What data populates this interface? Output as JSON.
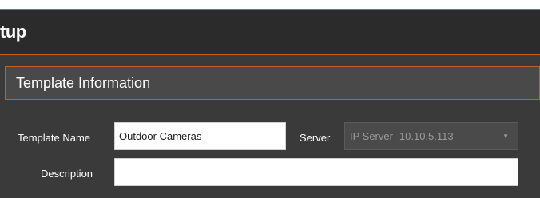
{
  "dialog": {
    "title": "tup"
  },
  "section": {
    "title": "Template Information"
  },
  "form": {
    "template_name_label": "Template Name",
    "template_name_value": "Outdoor Cameras",
    "server_label": "Server",
    "server_value": "IP Server -10.10.5.113",
    "description_label": "Description",
    "description_value": ""
  },
  "colors": {
    "accent": "#b8652a",
    "panel": "#3a3a3a",
    "title_bar": "#2b2b2b"
  }
}
